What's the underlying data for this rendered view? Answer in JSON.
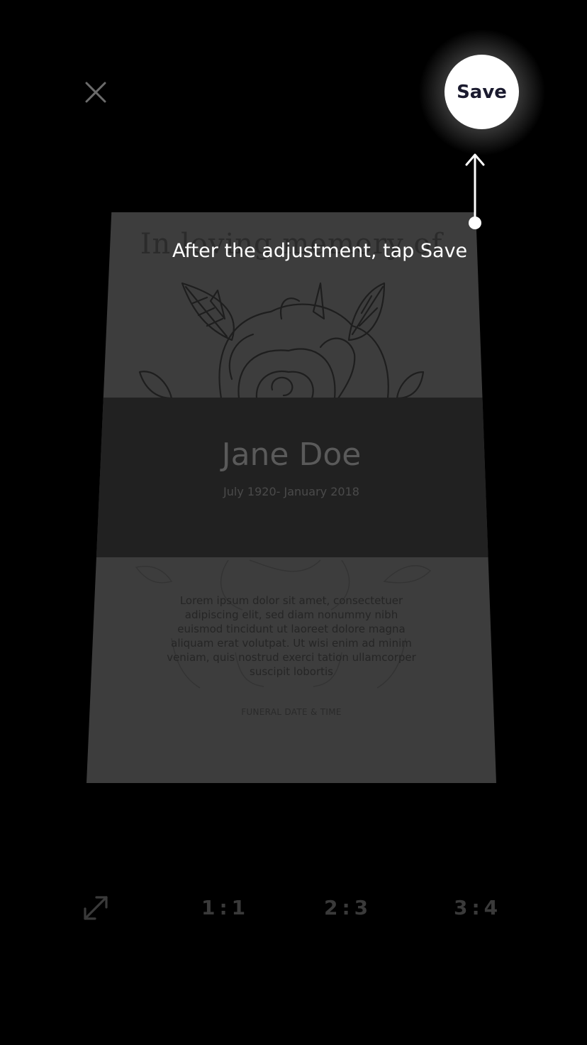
{
  "header": {
    "close_icon": "close-icon",
    "save_label": "Save"
  },
  "tooltip": {
    "text": "After the adjustment, tap Save",
    "arrow_icon": "arrow-up-icon"
  },
  "card": {
    "heading": "In loving memory of",
    "name": "Jane Doe",
    "dates": "July 1920- January 2018",
    "body": "Lorem ipsum dolor sit amet, consectetuer adipiscing elit, sed diam nonummy nibh euismod tincidunt ut laoreet dolore magna aliquam erat volutpat. Ut wisi enim ad minim veniam, quis nostrud exerci tation ullamcorper suscipit lobortis",
    "event_label": "FUNERAL DATE & TIME",
    "decoration": "rose-illustration"
  },
  "toolbar": {
    "free_icon": "expand-diagonal-icon",
    "ratios": [
      "1:1",
      "2:3",
      "3:4"
    ]
  },
  "colors": {
    "background": "#000000",
    "save_button": "#ffffff",
    "save_text": "#1a1a2e",
    "card_dimmed": "#3d3d3d",
    "band": "#212121"
  }
}
